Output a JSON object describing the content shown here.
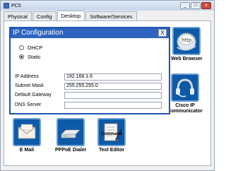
{
  "window": {
    "title": "PC5",
    "minimize": "_",
    "maximize": "□",
    "close": "x"
  },
  "tabs": [
    {
      "label": "Physical"
    },
    {
      "label": "Config"
    },
    {
      "label": "Desktop"
    },
    {
      "label": "Software/Services"
    }
  ],
  "dialog": {
    "title": "IP Configuration",
    "close_label": "X",
    "dhcp_label": "DHCP",
    "static_label": "Static",
    "selected_mode": "Static",
    "fields": {
      "ip_label": "IP Address",
      "ip_value": "192.168.1.6",
      "mask_label": "Subnet Mask",
      "mask_value": "255.255.255.0",
      "gateway_label": "Default Gateway",
      "gateway_value": "",
      "dns_label": "DNS Server",
      "dns_value": ""
    }
  },
  "desktop_icons": {
    "web_browser": "Web Browser",
    "cisco_ip_communicator": "Cisco IP Communicator",
    "email": "E Mail",
    "pppoe_dialer": "PPPoE Dialer",
    "text_editor": "Text Editor",
    "hidden_label_fragment": "Command"
  },
  "colors": {
    "dialog_title": "#2e64c0",
    "icon_tile": "#0d5aa8"
  }
}
